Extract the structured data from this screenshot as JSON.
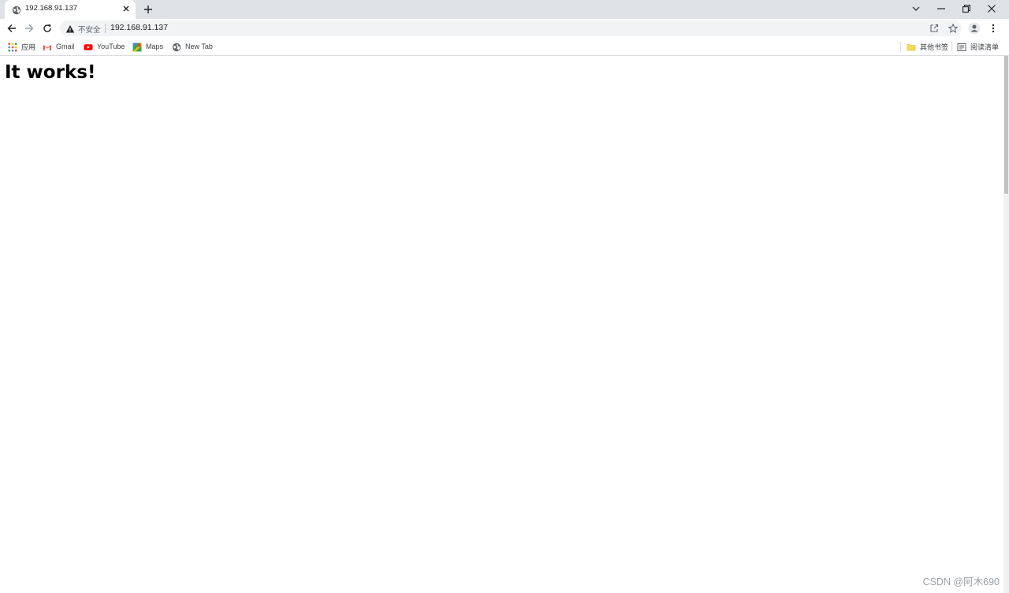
{
  "tab": {
    "title": "192.168.91.137",
    "favicon": "globe-icon"
  },
  "toolbar": {
    "security_label": "不安全",
    "url": "192.168.91.137"
  },
  "bookmarks": {
    "left": [
      {
        "label": "应用",
        "icon": "apps-grid-icon"
      },
      {
        "label": "Gmail",
        "icon": "gmail-icon"
      },
      {
        "label": "YouTube",
        "icon": "youtube-icon"
      },
      {
        "label": "Maps",
        "icon": "maps-icon"
      },
      {
        "label": "New Tab",
        "icon": "globe-icon"
      }
    ],
    "other": "其他书签",
    "reading_list": "阅读清单"
  },
  "page": {
    "heading": "It works!"
  },
  "watermark": "CSDN @阿木690",
  "colors": {
    "tabstrip": "#dee1e6",
    "omnibox": "#f1f3f4",
    "youtube_red": "#ff0000",
    "gmail_red": "#ea4335"
  }
}
